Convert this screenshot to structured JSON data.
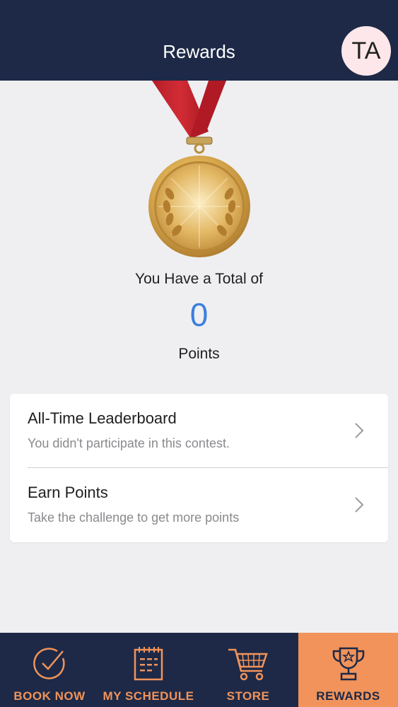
{
  "header": {
    "title": "Rewards",
    "avatar_initials": "TA"
  },
  "summary": {
    "caption": "You Have a Total of",
    "points": "0",
    "unit": "Points"
  },
  "list": [
    {
      "title": "All-Time Leaderboard",
      "subtitle": "You didn't participate in this contest."
    },
    {
      "title": "Earn Points",
      "subtitle": "Take the challenge to get more points"
    }
  ],
  "tabs": [
    {
      "label": "BOOK NOW",
      "icon": "check-circle-icon"
    },
    {
      "label": "MY SCHEDULE",
      "icon": "calendar-icon"
    },
    {
      "label": "STORE",
      "icon": "cart-icon"
    },
    {
      "label": "REWARDS",
      "icon": "trophy-icon",
      "active": true
    }
  ],
  "colors": {
    "navy": "#1d2947",
    "accent": "#f1935a",
    "points_blue": "#3d7fdd",
    "ribbon_red": "#c8232e",
    "medal_gold": "#d9a94a"
  }
}
